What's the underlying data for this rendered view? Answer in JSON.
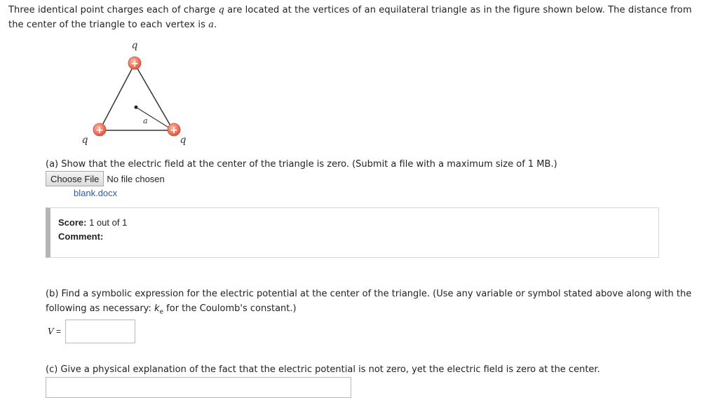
{
  "question": {
    "intro_part1": "Three identical point charges each of charge ",
    "intro_q": "q",
    "intro_part2": " are located at the vertices of an equilateral triangle as in the figure shown below. The distance from the center of the triangle to each vertex is ",
    "intro_a": "a",
    "intro_end": "."
  },
  "figure": {
    "top_charge_label": "q",
    "left_charge_label": "q",
    "right_charge_label": "q",
    "distance_label": "a",
    "charge_sign": "+",
    "charge_color": "#f0806a"
  },
  "part_a": {
    "text": "(a) Show that the electric field at the center of the triangle is zero. (Submit a file with a maximum size of 1 MB.)",
    "choose_file_label": "Choose File",
    "no_file_text": "No file chosen",
    "uploaded_file": "blank.docx"
  },
  "score": {
    "score_label": "Score:",
    "score_value": "1 out of 1",
    "comment_label": "Comment:"
  },
  "part_b": {
    "text_before": "(b) Find a symbolic expression for the electric potential at the center of the triangle. (Use any variable or symbol stated above along with the following as necessary: ",
    "k": "k",
    "k_sub": "e",
    "text_after": " for the Coulomb's constant.)",
    "v_symbol": "V",
    "v_equals": " =",
    "v_value": ""
  },
  "part_c": {
    "text": "(c) Give a physical explanation of the fact that the electric potential is not zero, yet the electric field is zero at the center."
  }
}
